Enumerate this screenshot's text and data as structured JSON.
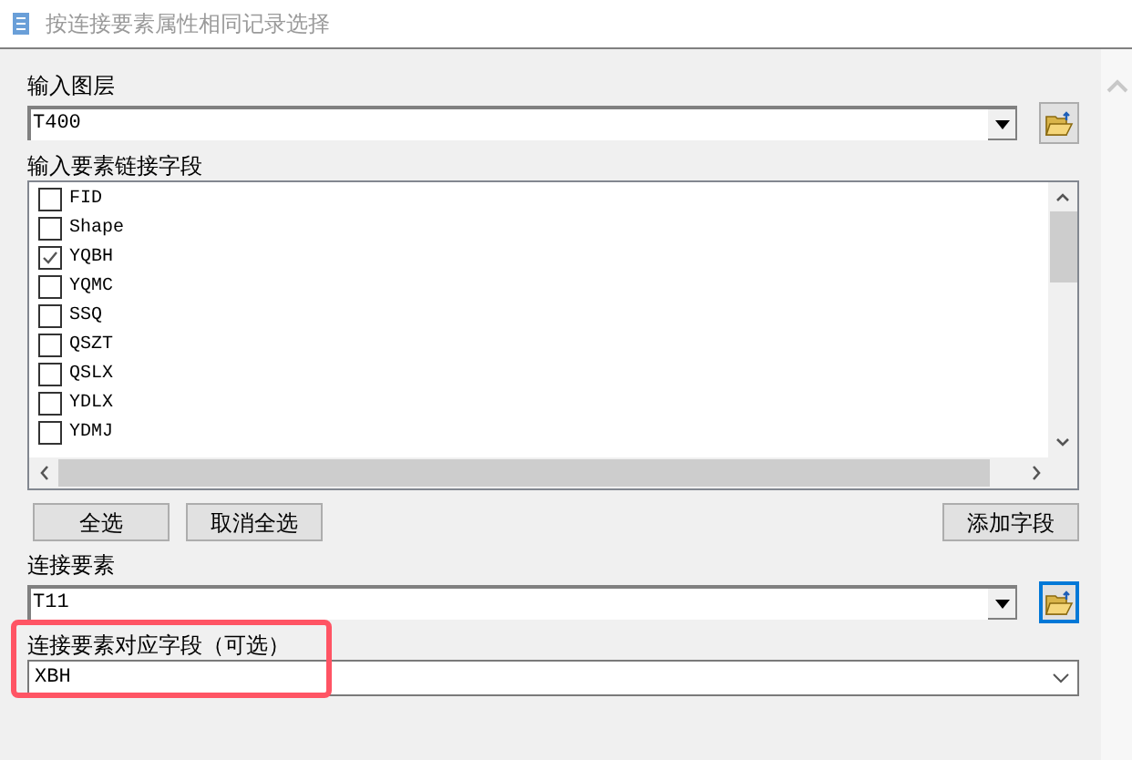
{
  "window": {
    "title": "按连接要素属性相同记录选择"
  },
  "input_layer": {
    "label": "输入图层",
    "value": "T400"
  },
  "link_fields": {
    "label": "输入要素链接字段",
    "items": [
      {
        "name": "FID",
        "checked": false
      },
      {
        "name": "Shape",
        "checked": false
      },
      {
        "name": "YQBH",
        "checked": true
      },
      {
        "name": "YQMC",
        "checked": false
      },
      {
        "name": "SSQ",
        "checked": false
      },
      {
        "name": "QSZT",
        "checked": false
      },
      {
        "name": "QSLX",
        "checked": false
      },
      {
        "name": "YDLX",
        "checked": false
      },
      {
        "name": "YDMJ",
        "checked": false
      }
    ]
  },
  "buttons": {
    "select_all": "全选",
    "clear_all": "取消全选",
    "add_field": "添加字段"
  },
  "join_layer": {
    "label": "连接要素",
    "value": "T11"
  },
  "join_field": {
    "label": "连接要素对应字段（可选）",
    "value": "XBH",
    "highlighted": true
  }
}
